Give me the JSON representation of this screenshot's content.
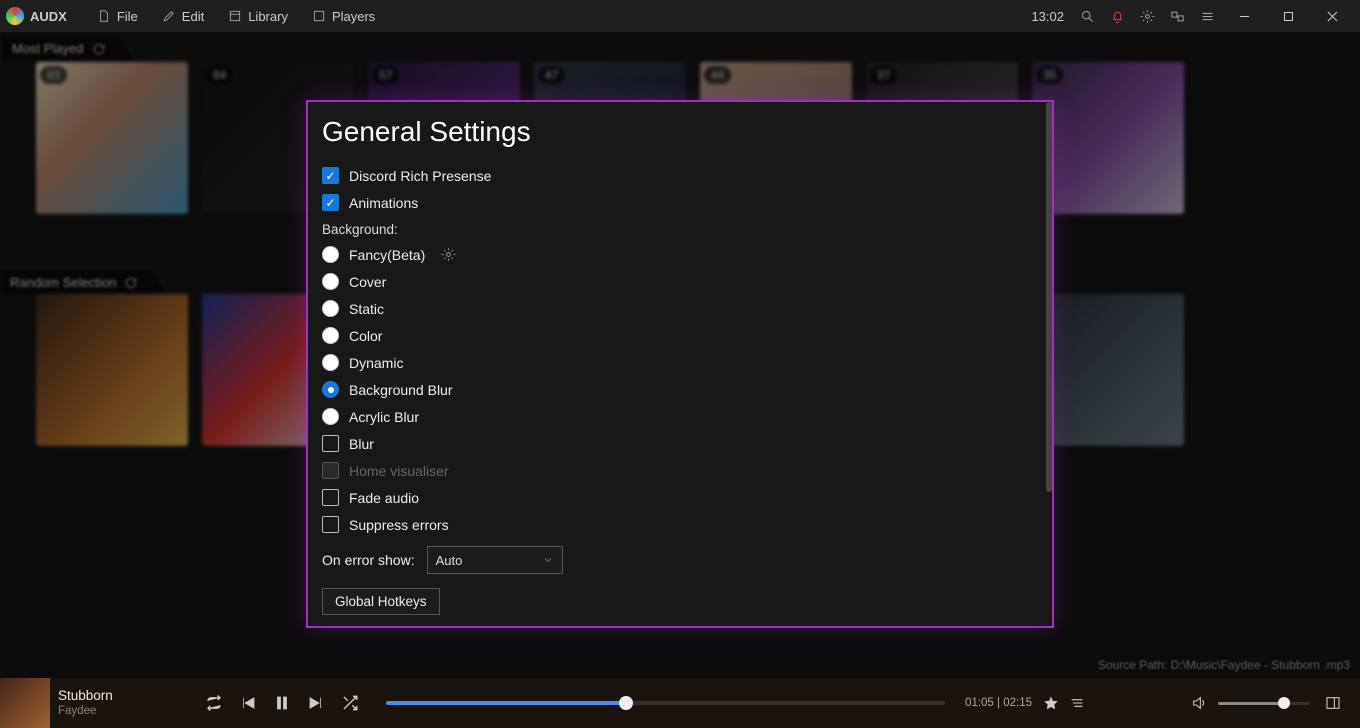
{
  "app_name": "AUDX",
  "menu": {
    "file": "File",
    "edit": "Edit",
    "library": "Library",
    "players": "Players"
  },
  "clock": "13:02",
  "sections": {
    "most_played": "Most Played",
    "random_selection": "Random Selection"
  },
  "most_played_counts": [
    "83",
    "64",
    "57",
    "47",
    "44",
    "37",
    "35"
  ],
  "source_path": "Source Path: D:\\Music\\Faydee - Stubborn .mp3",
  "modal": {
    "title": "General Settings",
    "discord": "Discord Rich Presense",
    "animations": "Animations",
    "background": "Background:",
    "bg_options": {
      "fancy": "Fancy(Beta)",
      "cover": "Cover",
      "static": "Static",
      "color": "Color",
      "dynamic": "Dynamic",
      "bgblur": "Background Blur",
      "acrylic": "Acrylic Blur"
    },
    "blur": "Blur",
    "home_vis": "Home visualiser",
    "fade": "Fade audio",
    "suppress": "Suppress errors",
    "on_error": "On error show:",
    "on_error_val": "Auto",
    "hotkeys": "Global Hotkeys"
  },
  "player": {
    "title": "Stubborn",
    "artist": "Faydee",
    "elapsed": "01:05",
    "total": "02:15",
    "time_sep": " | "
  }
}
